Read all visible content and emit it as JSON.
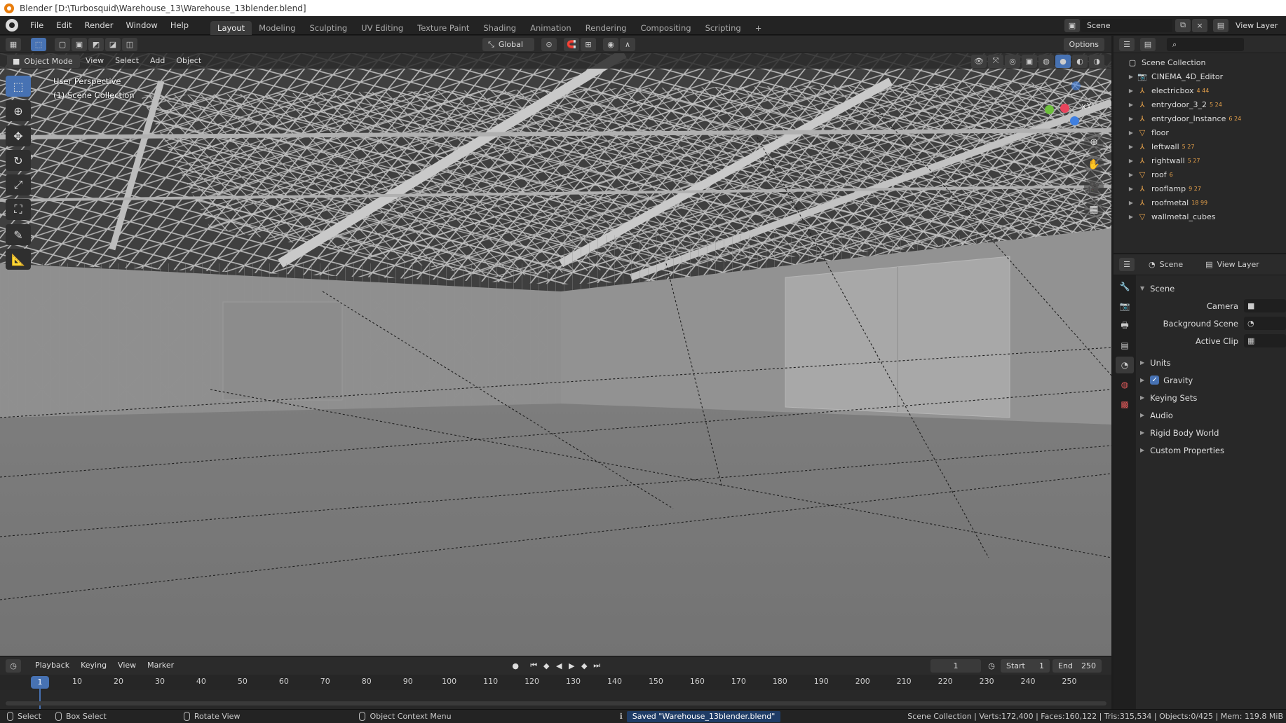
{
  "window": {
    "title": "Blender [D:\\Turbosquid\\Warehouse_13\\Warehouse_13blender.blend]"
  },
  "menubar": {
    "menus": [
      "File",
      "Edit",
      "Render",
      "Window",
      "Help"
    ],
    "workspaces": [
      "Layout",
      "Modeling",
      "Sculpting",
      "UV Editing",
      "Texture Paint",
      "Shading",
      "Animation",
      "Rendering",
      "Compositing",
      "Scripting"
    ],
    "active_workspace": "Layout",
    "add_tab": "+",
    "scene_name": "Scene",
    "view_layer": "View Layer"
  },
  "tool_header": {
    "orientation": "Global",
    "options_label": "Options"
  },
  "viewport_header": {
    "mode": "Object Mode",
    "menus": [
      "View",
      "Select",
      "Add",
      "Object"
    ]
  },
  "viewport": {
    "perspective_label": "User Perspective",
    "collection_label": "(1) Scene Collection",
    "gizmo_axes": [
      "X",
      "Y",
      "Z"
    ]
  },
  "outliner": {
    "root": "Scene Collection",
    "items": [
      {
        "name": "CINEMA_4D_Editor",
        "type": "cam",
        "badge": ""
      },
      {
        "name": "electricbox",
        "type": "empty",
        "badge": "4 44"
      },
      {
        "name": "entrydoor_3_2",
        "type": "empty",
        "badge": "5 24"
      },
      {
        "name": "entrydoor_Instance",
        "type": "empty",
        "badge": "6 24"
      },
      {
        "name": "floor",
        "type": "mesh",
        "badge": ""
      },
      {
        "name": "leftwall",
        "type": "empty",
        "badge": "5 27"
      },
      {
        "name": "rightwall",
        "type": "empty",
        "badge": "5 27"
      },
      {
        "name": "roof",
        "type": "mesh",
        "badge": "6"
      },
      {
        "name": "rooflamp",
        "type": "empty",
        "badge": "9 27"
      },
      {
        "name": "roofmetal",
        "type": "empty",
        "badge": "18 99"
      },
      {
        "name": "wallmetal_cubes",
        "type": "mesh",
        "badge": ""
      }
    ]
  },
  "properties": {
    "breadcrumb_scene": "Scene",
    "breadcrumb_layer": "View Layer",
    "panel_title": "Scene",
    "fields": [
      {
        "label": "Camera"
      },
      {
        "label": "Background Scene"
      },
      {
        "label": "Active Clip"
      }
    ],
    "sections": [
      "Units",
      "Gravity",
      "Keying Sets",
      "Audio",
      "Rigid Body World",
      "Custom Properties"
    ],
    "gravity_checked": true
  },
  "timeline": {
    "menus": [
      "Playback",
      "Keying",
      "View",
      "Marker"
    ],
    "current_frame": "1",
    "start_label": "Start",
    "start_value": "1",
    "end_label": "End",
    "end_value": "250",
    "ruler_ticks": [
      "1",
      "10",
      "20",
      "30",
      "40",
      "50",
      "60",
      "70",
      "80",
      "90",
      "100",
      "110",
      "120",
      "130",
      "140",
      "150",
      "160",
      "170",
      "180",
      "190",
      "200",
      "210",
      "220",
      "230",
      "240",
      "250"
    ]
  },
  "statusbar": {
    "select": "Select",
    "box_select": "Box Select",
    "rotate_view": "Rotate View",
    "context_menu": "Object Context Menu",
    "saved_message": "Saved \"Warehouse_13blender.blend\"",
    "stats": "Scene Collection | Verts:172,400 | Faces:160,122 | Tris:315,534 | Objects:0/425 | Mem: 119.8 MiB"
  },
  "colors": {
    "accent": "#4772b3",
    "viewport_bg": "#7a7a7a",
    "panel_bg": "#282828",
    "axis_x": "#e8445c",
    "axis_y": "#6dbf3c",
    "axis_z": "#3f7fe0"
  }
}
